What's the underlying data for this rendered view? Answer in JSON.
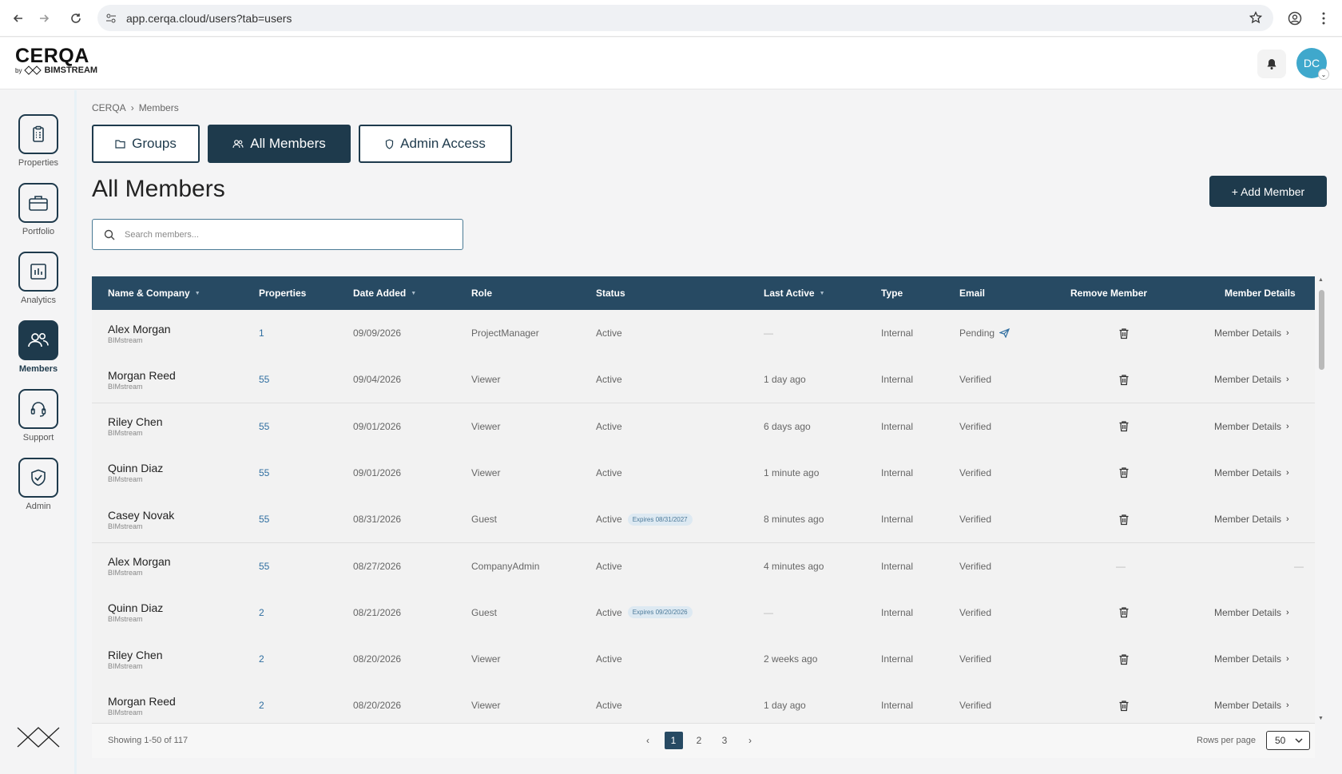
{
  "browser": {
    "url": "app.cerqa.cloud/users?tab=users"
  },
  "header": {
    "logo_main": "CERQA",
    "logo_by": "by",
    "logo_brand": "BIMSTREAM",
    "avatar_initials": "DC"
  },
  "sidebar": {
    "items": [
      {
        "label": "Properties",
        "icon": "clipboard-icon"
      },
      {
        "label": "Portfolio",
        "icon": "briefcase-icon"
      },
      {
        "label": "Analytics",
        "icon": "bar-chart-icon"
      },
      {
        "label": "Members",
        "icon": "users-icon",
        "active": true
      },
      {
        "label": "Support",
        "icon": "headset-icon"
      },
      {
        "label": "Admin",
        "icon": "shield-check-icon"
      }
    ]
  },
  "breadcrumb": {
    "root": "CERQA",
    "sep": "›",
    "current": "Members"
  },
  "tabs": [
    {
      "label": "Groups",
      "icon": "folder-icon"
    },
    {
      "label": "All Members",
      "icon": "users-icon",
      "active": true
    },
    {
      "label": "Admin Access",
      "icon": "shield-icon"
    }
  ],
  "page": {
    "title": "All Members",
    "add_button": "+ Add Member"
  },
  "search": {
    "placeholder": "Search members..."
  },
  "table": {
    "columns": [
      "Name & Company",
      "Properties",
      "Date Added",
      "Role",
      "Status",
      "Last Active",
      "Type",
      "Email",
      "Remove Member",
      "Member Details"
    ],
    "rows": [
      {
        "name": "Alex Morgan",
        "company": "BIMstream",
        "properties": "1",
        "date": "09/09/2026",
        "role": "ProjectManager",
        "status": "Active",
        "badge": "",
        "last_active": "—",
        "type": "Internal",
        "email": "Pending",
        "removable": true,
        "details": "Member Details"
      },
      {
        "name": "Morgan Reed",
        "company": "BIMstream",
        "properties": "55",
        "date": "09/04/2026",
        "role": "Viewer",
        "status": "Active",
        "badge": "",
        "last_active": "1 day ago",
        "type": "Internal",
        "email": "Verified",
        "removable": true,
        "details": "Member Details"
      },
      {
        "name": "Riley Chen",
        "company": "BIMstream",
        "properties": "55",
        "date": "09/01/2026",
        "role": "Viewer",
        "status": "Active",
        "badge": "",
        "last_active": "6 days ago",
        "type": "Internal",
        "email": "Verified",
        "removable": true,
        "details": "Member Details"
      },
      {
        "name": "Quinn Diaz",
        "company": "BIMstream",
        "properties": "55",
        "date": "09/01/2026",
        "role": "Viewer",
        "status": "Active",
        "badge": "",
        "last_active": "1 minute ago",
        "type": "Internal",
        "email": "Verified",
        "removable": true,
        "details": "Member Details"
      },
      {
        "name": "Casey Novak",
        "company": "BIMstream",
        "properties": "55",
        "date": "08/31/2026",
        "role": "Guest",
        "status": "Active",
        "badge": "Expires 08/31/2027",
        "last_active": "8 minutes ago",
        "type": "Internal",
        "email": "Verified",
        "removable": true,
        "details": "Member Details"
      },
      {
        "name": "Alex Morgan",
        "company": "BIMstream",
        "properties": "55",
        "date": "08/27/2026",
        "role": "CompanyAdmin",
        "status": "Active",
        "badge": "",
        "last_active": "4 minutes ago",
        "type": "Internal",
        "email": "Verified",
        "removable": false,
        "details": "—"
      },
      {
        "name": "Quinn Diaz",
        "company": "BIMstream",
        "properties": "2",
        "date": "08/21/2026",
        "role": "Guest",
        "status": "Active",
        "badge": "Expires 09/20/2026",
        "last_active": "—",
        "type": "Internal",
        "email": "Verified",
        "removable": true,
        "details": "Member Details"
      },
      {
        "name": "Riley Chen",
        "company": "BIMstream",
        "properties": "2",
        "date": "08/20/2026",
        "role": "Viewer",
        "status": "Active",
        "badge": "",
        "last_active": "2 weeks ago",
        "type": "Internal",
        "email": "Verified",
        "removable": true,
        "details": "Member Details"
      },
      {
        "name": "Morgan Reed",
        "company": "BIMstream",
        "properties": "2",
        "date": "08/20/2026",
        "role": "Viewer",
        "status": "Active",
        "badge": "",
        "last_active": "1 day ago",
        "type": "Internal",
        "email": "Verified",
        "removable": true,
        "details": "Member Details"
      }
    ]
  },
  "footer": {
    "showing": "Showing 1-50 of 117",
    "prev": "‹",
    "pages": [
      "1",
      "2",
      "3"
    ],
    "current_page": "1",
    "next": "›",
    "rows_per_page_label": "Rows per page",
    "rows_per_page_value": "50"
  },
  "colors": {
    "primary": "#1e3a4c",
    "header": "#274a63",
    "accent": "#3fa8cc",
    "link": "#2f6ea0"
  }
}
